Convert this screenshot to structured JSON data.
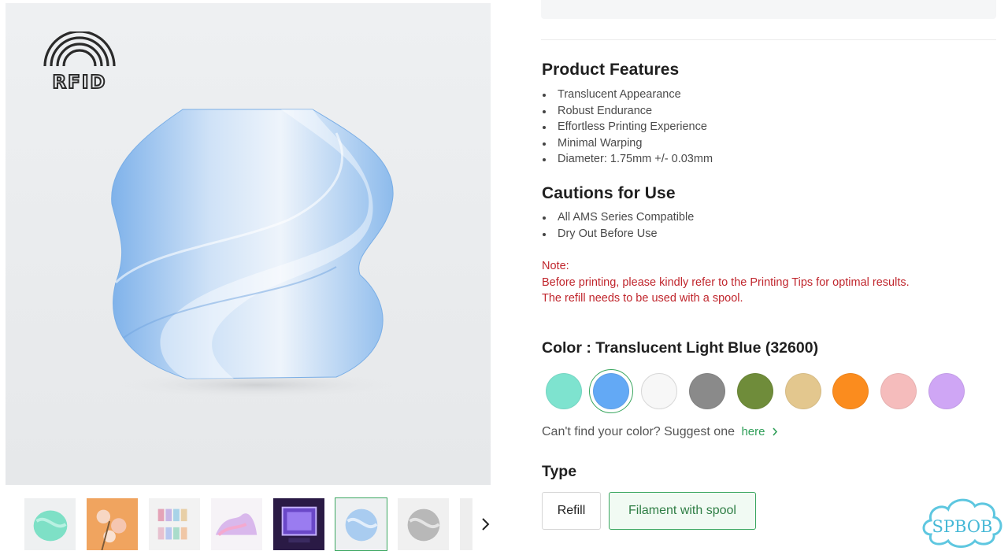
{
  "gallery": {
    "rfid_label": "RFID",
    "thumbnails": [
      {
        "name": "mint-vase",
        "color": "#7ee0c6"
      },
      {
        "name": "orange-flowers",
        "color": "#f2a25c"
      },
      {
        "name": "filament-rainbow",
        "color": "#e8c9d4"
      },
      {
        "name": "pink-wave",
        "color": "#dcbfe6"
      },
      {
        "name": "purple-lamp",
        "color": "#5c3ea8"
      },
      {
        "name": "light-blue-vase",
        "color": "#a9ccf0",
        "selected": true
      },
      {
        "name": "gray-vase",
        "color": "#b8b8b8"
      },
      {
        "name": "partial-thumb",
        "color": "#dddddd"
      }
    ],
    "next_icon": "chevron-right-icon"
  },
  "features": {
    "title": "Product Features",
    "items": [
      "Translucent Appearance",
      "Robust Endurance",
      "Effortless Printing Experience",
      "Minimal Warping",
      "Diameter: 1.75mm +/- 0.03mm"
    ]
  },
  "cautions": {
    "title": "Cautions for Use",
    "items": [
      "All AMS Series Compatible",
      "Dry Out Before Use"
    ]
  },
  "note": {
    "label": "Note:",
    "line1": "Before printing, please kindly refer to the Printing Tips for optimal results.",
    "line2": "The refill needs to be used with a spool."
  },
  "color": {
    "heading": "Color : Translucent Light Blue (32600)",
    "swatches": [
      {
        "name": "mint",
        "hex": "#7ee3cf"
      },
      {
        "name": "light-blue",
        "hex": "#63a9f5",
        "selected": true
      },
      {
        "name": "white",
        "hex": "#f7f7f7"
      },
      {
        "name": "gray",
        "hex": "#8a8a8a"
      },
      {
        "name": "olive",
        "hex": "#6f8c3a"
      },
      {
        "name": "beige",
        "hex": "#e3c78e"
      },
      {
        "name": "orange",
        "hex": "#fb8c1e"
      },
      {
        "name": "pink",
        "hex": "#f5bcbc"
      },
      {
        "name": "lavender",
        "hex": "#cfa6f5"
      }
    ],
    "suggest_text": "Can't find your color? Suggest one",
    "suggest_link": "here"
  },
  "type": {
    "heading": "Type",
    "options": [
      "Refill",
      "Filament with spool"
    ],
    "selected": "Filament with spool"
  },
  "watermark": {
    "text": "SPBOB"
  },
  "accent": "#3aa65f",
  "note_color": "#c0262d"
}
